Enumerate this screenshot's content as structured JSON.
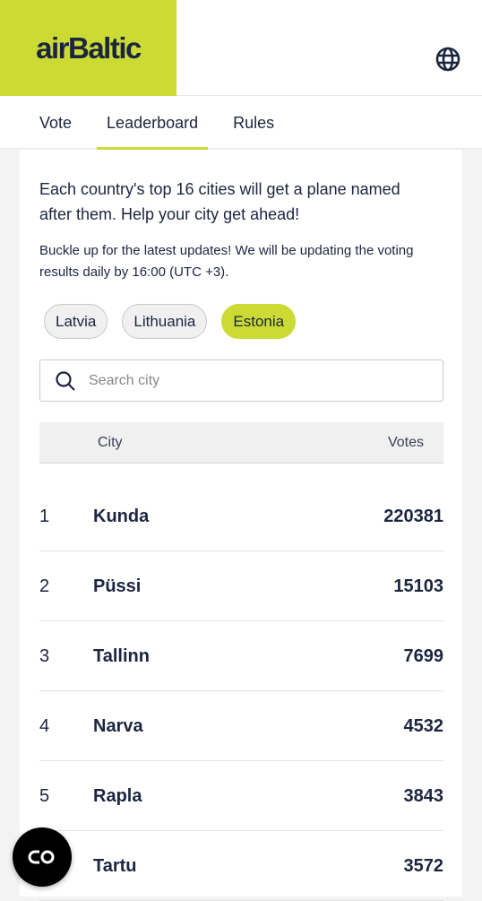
{
  "header": {
    "logo": "airBaltic",
    "language_icon": "globe-icon"
  },
  "tabs": [
    {
      "label": "Vote"
    },
    {
      "label": "Leaderboard",
      "active": true
    },
    {
      "label": "Rules"
    }
  ],
  "intro": "Each country's top 16 cities will get a plane named after them. Help your city get ahead!",
  "note": "Buckle up for the latest updates! We will be updating the voting results daily by 16:00 (UTC +3).",
  "countries": [
    {
      "label": "Latvia"
    },
    {
      "label": "Lithuania"
    },
    {
      "label": "Estonia",
      "active": true
    }
  ],
  "search": {
    "placeholder": "Search city"
  },
  "table": {
    "city_header": "City",
    "votes_header": "Votes",
    "rows": [
      {
        "rank": "1",
        "city": "Kunda",
        "votes": "220381"
      },
      {
        "rank": "2",
        "city": "Püssi",
        "votes": "15103"
      },
      {
        "rank": "3",
        "city": "Tallinn",
        "votes": "7699"
      },
      {
        "rank": "4",
        "city": "Narva",
        "votes": "4532"
      },
      {
        "rank": "5",
        "city": "Rapla",
        "votes": "3843"
      },
      {
        "rank": "6",
        "city": "Tartu",
        "votes": "3572"
      }
    ]
  },
  "colors": {
    "accent": "#ccdb33",
    "text": "#1b2540"
  }
}
